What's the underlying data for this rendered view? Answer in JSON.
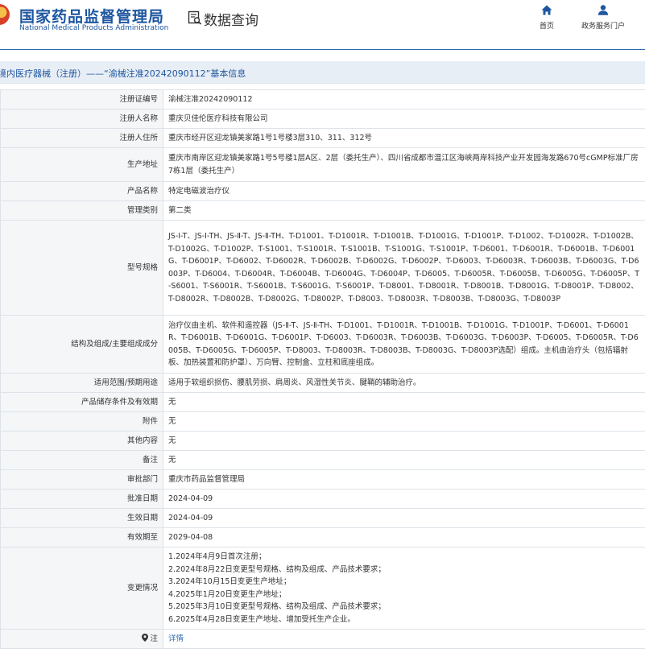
{
  "header": {
    "site_title_cn": "国家药品监督管理局",
    "site_title_en": "National Medical Products Administration",
    "section_title": "数据查询",
    "nav": [
      {
        "label": "首页",
        "icon": "home-icon"
      },
      {
        "label": "政务服务门户",
        "icon": "user-icon"
      }
    ]
  },
  "breadcrumb": "境内医疗器械（注册）——“渝械注准20242090112”基本信息",
  "fields": [
    {
      "label": "注册证编号",
      "value": "渝械注准20242090112"
    },
    {
      "label": "注册人名称",
      "value": "重庆贝佳伦医疗科技有限公司"
    },
    {
      "label": "注册人住所",
      "value": "重庆市经开区迎龙镇美家路1号1号楼3层310、311、312号"
    },
    {
      "label": "生产地址",
      "value": "重庆市南岸区迎龙镇美家路1号5号楼1层A区、2层（委托生产）、四川省成都市温江区海峡两岸科技产业开发园海发路670号cGMP标准厂房7栋1层（委托生产）"
    },
    {
      "label": "产品名称",
      "value": "特定电磁波治疗仪"
    },
    {
      "label": "管理类别",
      "value": "第二类"
    },
    {
      "label": "型号规格",
      "value": "JS-Ⅰ-T、JS-Ⅰ-TH、JS-Ⅱ-T、JS-Ⅱ-TH、T-D1001、T-D1001R、T-D1001B、T-D1001G、T-D1001P、T-D1002、T-D1002R、T-D1002B、T-D1002G、T-D1002P、T-S1001、T-S1001R、T-S1001B、T-S1001G、T-S1001P、T-D6001、T-D6001R、T-D6001B、T-D6001G、T-D6001P、T-D6002、T-D6002R、T-D6002B、T-D6002G、T-D6002P、T-D6003、T-D6003R、T-D6003B、T-D6003G、T-D6003P、T-D6004、T-D6004R、T-D6004B、T-D6004G、T-D6004P、T-D6005、T-D6005R、T-D6005B、T-D6005G、T-D6005P、T-S6001、T-S6001R、T-S6001B、T-S6001G、T-S6001P、T-D8001、T-D8001R、T-D8001B、T-D8001G、T-D8001P、T-D8002、T-D8002R、T-D8002B、T-D8002G、T-D8002P、T-D8003、T-D8003R、T-D8003B、T-D8003G、T-D8003P"
    },
    {
      "label": "结构及组成/主要组成成分",
      "value": "治疗仪由主机、软件和遥控器（JS-Ⅱ-T、JS-Ⅱ-TH、T-D1001、T-D1001R、T-D1001B、T-D1001G、T-D1001P、T-D6001、T-D6001R、T-D6001B、T-D6001G、T-D6001P、T-D6003、T-D6003R、T-D6003B、T-D6003G、T-D6003P、T-D6005、T-D6005R、T-D6005B、T-D6005G、T-D6005P、T-D8003、T-D8003R、T-D8003B、T-D8003G、T-D8003P选配）组成。主机由治疗头（包括辐射板、加热装置和防护罩）、万向臂、控制盒、立柱和底座组成。"
    },
    {
      "label": "适用范围/预期用途",
      "value": "适用于软组织损伤、腰肌劳损、肩周炎、风湿性关节炎、腱鞘的辅助治疗。"
    },
    {
      "label": "产品储存条件及有效期",
      "value": "无"
    },
    {
      "label": "附件",
      "value": "无"
    },
    {
      "label": "其他内容",
      "value": "无"
    },
    {
      "label": "备注",
      "value": "无"
    },
    {
      "label": "审批部门",
      "value": "重庆市药品监督管理局"
    },
    {
      "label": "批准日期",
      "value": "2024-04-09"
    },
    {
      "label": "生效日期",
      "value": "2024-04-09"
    },
    {
      "label": "有效期至",
      "value": "2029-04-08"
    }
  ],
  "change_history": {
    "label": "变更情况",
    "items": [
      "1.2024年4月9日首次注册；",
      "2.2024年8月22日变更型号规格、结构及组成、产品技术要求；",
      "3.2024年10月15日变更生产地址；",
      "4.2025年1月20日变更生产地址；",
      "5.2025年3月10日变更型号规格、结构及组成、产品技术要求；",
      "6.2025年4月28日变更生产地址、增加受托生产企业。"
    ]
  },
  "note_row": {
    "label": "注",
    "icon": "map-pin-icon",
    "link_text": "详情"
  },
  "colors": {
    "brand_blue": "#1e56a0",
    "link_blue": "#2b6cb0",
    "breadcrumb_bg": "#e8eef5",
    "label_bg": "#f4f6f8"
  }
}
